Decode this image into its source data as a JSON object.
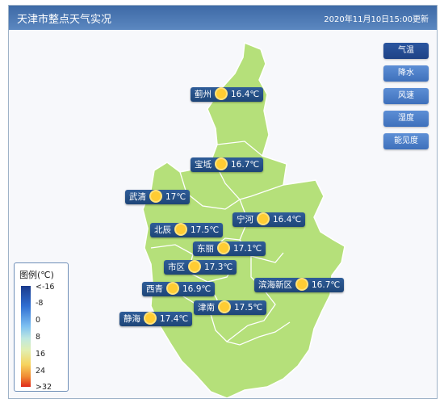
{
  "header": {
    "title": "天津市整点天气实况",
    "timestamp": "2020年11月10日15:00更新"
  },
  "tabs": [
    "气温",
    "降水",
    "风速",
    "湿度",
    "能见度"
  ],
  "active_tab": "气温",
  "stations": [
    {
      "name": "蓟州",
      "temp": "16.4℃",
      "weather": "sun-icon"
    },
    {
      "name": "宝坻",
      "temp": "16.7℃",
      "weather": "sun-icon"
    },
    {
      "name": "武清",
      "temp": "17℃",
      "weather": "sun-icon"
    },
    {
      "name": "宁河",
      "temp": "16.4℃",
      "weather": "sun-icon"
    },
    {
      "name": "北辰",
      "temp": "17.5℃",
      "weather": "sun-icon"
    },
    {
      "name": "东丽",
      "temp": "17.1℃",
      "weather": "sun-icon"
    },
    {
      "name": "市区",
      "temp": "17.3℃",
      "weather": "sun-icon"
    },
    {
      "name": "滨海新区",
      "temp": "16.7℃",
      "weather": "sun-icon"
    },
    {
      "name": "西青",
      "temp": "16.9℃",
      "weather": "sun-icon"
    },
    {
      "name": "津南",
      "temp": "17.5℃",
      "weather": "sun-icon"
    },
    {
      "name": "静海",
      "temp": "17.4℃",
      "weather": "sun-icon"
    }
  ],
  "legend": {
    "title": "图例(℃)",
    "ticks": [
      "<-16",
      "-8",
      "0",
      "8",
      "16",
      "24",
      ">32"
    ]
  },
  "colors": {
    "map_fill": "#b5e07a",
    "header": "#4a78b4",
    "label_bg": "#264f86"
  }
}
